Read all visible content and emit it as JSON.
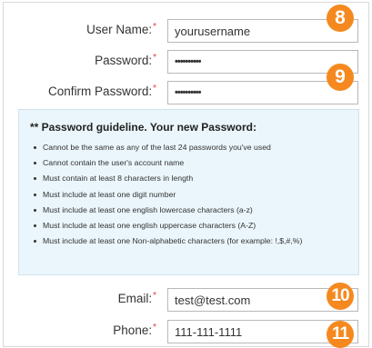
{
  "form": {
    "username": {
      "label": "User Name:",
      "value": "yourusername"
    },
    "password": {
      "label": "Password:",
      "value": "••••••••••"
    },
    "confirm_password": {
      "label": "Confirm Password:",
      "value": "••••••••••"
    },
    "email": {
      "label": "Email:",
      "value": "test@test.com"
    },
    "phone": {
      "label": "Phone:",
      "value": "111-111-1111"
    },
    "required_marker": "*"
  },
  "guideline": {
    "title": "** Password guideline. Your new Password:",
    "items": [
      "Cannot be the same as any of the last 24 passwords you've used",
      "Cannot contain the user's account name",
      "Must contain at least 8 characters in length",
      "Must include at least one digit number",
      "Must include at least one english lowercase characters (a-z)",
      "Must include at least one english uppercase characters (A-Z)",
      "Must include at least one Non-alphabetic characters (for example: !,$,#,%)"
    ]
  },
  "badges": {
    "username": "8",
    "password": "9",
    "email": "10",
    "phone": "11"
  },
  "colors": {
    "badge": "#f5891f",
    "required": "#e53935",
    "guideline_bg": "#eaf6fb"
  }
}
